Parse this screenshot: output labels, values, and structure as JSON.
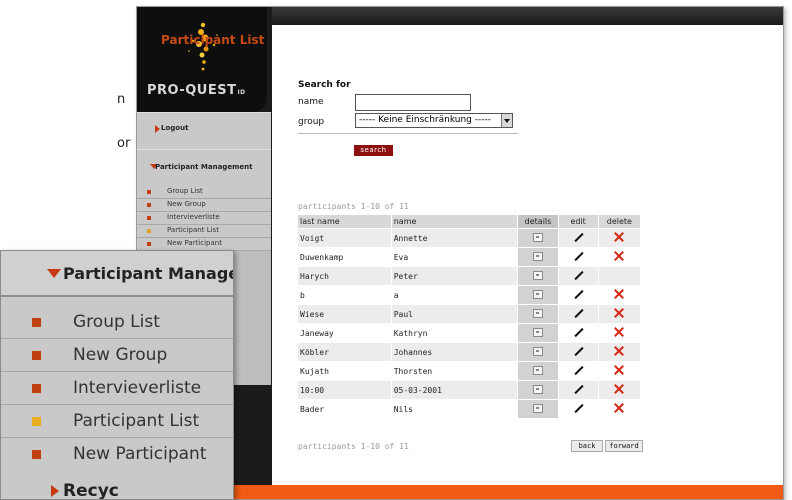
{
  "background_fragments": [
    "n",
    "or"
  ],
  "app": {
    "logo_text": "PRO-QUEST",
    "logo_suffix": "ID",
    "nav": {
      "logout": "Logout",
      "participant_management": "Participant Management",
      "items": [
        {
          "label": "Group List",
          "marker": "red"
        },
        {
          "label": "New Group",
          "marker": "red"
        },
        {
          "label": "Intervieverliste",
          "marker": "red"
        },
        {
          "label": "Participant List",
          "marker": "yellow"
        },
        {
          "label": "New Participant",
          "marker": "red"
        }
      ]
    },
    "page_title": "Participant List",
    "search": {
      "heading": "Search for",
      "name_label": "name",
      "name_value": "",
      "group_label": "group",
      "group_value": "----- Keine Einschränkung -----",
      "button_label": "search"
    },
    "pager_top": "participants  1-10  of  11",
    "pager_bottom": "participants  1-10  of  11",
    "table": {
      "headers": [
        "last name",
        "name",
        "details",
        "edit",
        "delete"
      ],
      "rows": [
        {
          "last": "Voigt",
          "name": "Annette",
          "delete": true
        },
        {
          "last": "Duwenkamp",
          "name": "Eva",
          "delete": true
        },
        {
          "last": "Harych",
          "name": "Peter",
          "delete": false
        },
        {
          "last": "b",
          "name": "a",
          "delete": true
        },
        {
          "last": "Wiese",
          "name": "Paul",
          "delete": true
        },
        {
          "last": "Janeway",
          "name": "Kathryn",
          "delete": true
        },
        {
          "last": "Köbler",
          "name": "Johannes",
          "delete": true
        },
        {
          "last": "Kujath",
          "name": "Thorsten",
          "delete": true
        },
        {
          "last": "10:00",
          "name": "05-03-2001",
          "delete": true
        },
        {
          "last": "Bader",
          "name": "Nils",
          "delete": true
        }
      ]
    },
    "back_label": "back",
    "forward_label": "forward"
  },
  "zoom": {
    "header": "Participant Managen",
    "items": [
      {
        "label": "Group List",
        "marker": "red"
      },
      {
        "label": "New Group",
        "marker": "red"
      },
      {
        "label": "Intervieverliste",
        "marker": "red"
      },
      {
        "label": "Participant List",
        "marker": "yellow"
      },
      {
        "label": "New Participant",
        "marker": "red"
      }
    ],
    "bottom_partial": "Recyc"
  },
  "colors": {
    "accent_orange": "#f05a14",
    "title_orange": "#c64a16",
    "button_dark_red": "#8e1111",
    "delete_red": "#d42a16"
  }
}
